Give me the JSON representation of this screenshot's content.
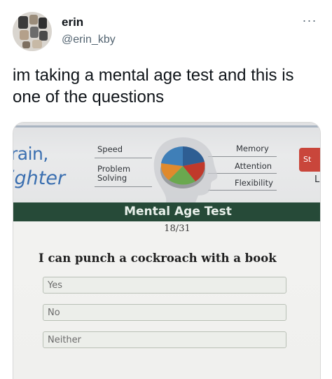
{
  "tweet": {
    "display_name": "erin",
    "handle": "@erin_kby",
    "more_icon": "more-dots-icon",
    "text": "im taking a mental age test and this is one of the questions"
  },
  "screen": {
    "brand_line1": "rain,",
    "brand_line2": "ighter",
    "labels": {
      "speed": "Speed",
      "problem_line1": "Problem",
      "problem_line2": "Solving",
      "memory": "Memory",
      "attention": "Attention",
      "flexibility": "Flexibility"
    },
    "start_partial": "St",
    "right_partial": "L",
    "test_title": "Mental Age Test",
    "progress": "18/31",
    "question": "I can punch a cockroach with a book",
    "options": [
      "Yes",
      "No",
      "Neither"
    ],
    "colors": {
      "header_green": "#264a38",
      "brand_blue": "#3b6fb0",
      "start_red": "#c9463b"
    }
  }
}
